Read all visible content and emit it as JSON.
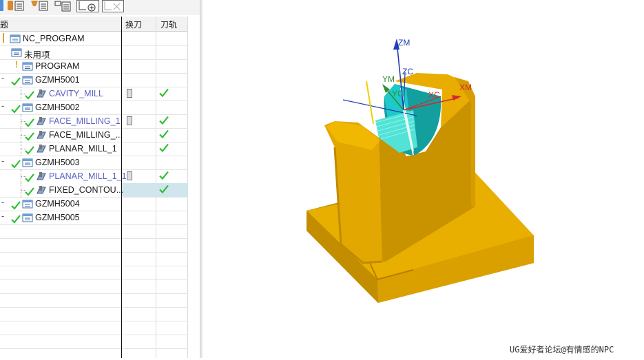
{
  "navigator": {
    "columns": {
      "name": "题",
      "tool_change": "换刀",
      "path": "刀轨"
    },
    "rows": [
      {
        "label": "NC_PROGRAM",
        "kind": "root"
      },
      {
        "label": "未用项",
        "kind": "folder"
      },
      {
        "label": "PROGRAM",
        "kind": "program",
        "status": "warning"
      },
      {
        "label": "GZMH5001",
        "kind": "program",
        "status": "ok"
      },
      {
        "label": "CAVITY_MILL",
        "kind": "operation",
        "status": "ok",
        "tool_change": true,
        "path_ok": true,
        "highlight": true
      },
      {
        "label": "GZMH5002",
        "kind": "program",
        "status": "ok"
      },
      {
        "label": "FACE_MILLING_1",
        "kind": "operation",
        "status": "ok",
        "tool_change": true,
        "path_ok": true,
        "highlight": true
      },
      {
        "label": "FACE_MILLING_...",
        "kind": "operation",
        "status": "ok",
        "path_ok": true
      },
      {
        "label": "PLANAR_MILL_1",
        "kind": "operation",
        "status": "ok",
        "path_ok": true
      },
      {
        "label": "GZMH5003",
        "kind": "program",
        "status": "ok"
      },
      {
        "label": "PLANAR_MILL_1_1",
        "kind": "operation",
        "status": "ok",
        "tool_change": true,
        "path_ok": true,
        "highlight": true
      },
      {
        "label": "FIXED_CONTOU...",
        "kind": "operation",
        "status": "ok",
        "path_ok": true,
        "selected": true
      },
      {
        "label": "GZMH5004",
        "kind": "program",
        "status": "ok"
      },
      {
        "label": "GZMH5005",
        "kind": "program",
        "status": "ok"
      }
    ]
  },
  "viewport": {
    "axes": {
      "zm": "ZM",
      "zc": "ZC",
      "ym": "YM",
      "yc": "YC",
      "xc": "XC",
      "xm": "XM"
    },
    "colors": {
      "part": "#e0a500",
      "part_dark": "#b88200",
      "cut": "#11b5b5",
      "axis_red": "#d42b2b",
      "axis_blue": "#1f3fb5",
      "axis_green": "#2f8f2f"
    }
  },
  "watermark": "UG爱好者论坛@有情感的NPC"
}
